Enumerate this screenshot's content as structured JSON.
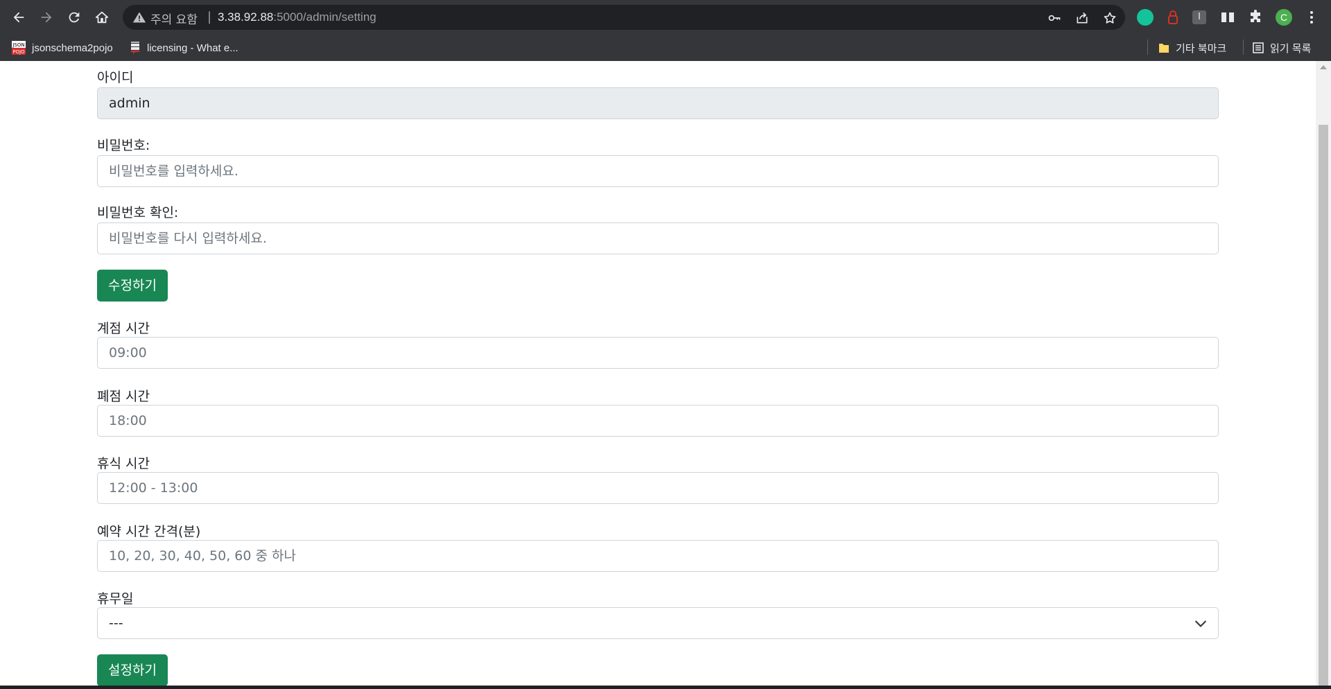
{
  "browser": {
    "security_warning": "주의 요함",
    "separator": "|",
    "url_host": "3.38.92.88",
    "url_path": ":5000/admin/setting",
    "profile_initial": "C",
    "extension_i_label": "I",
    "bookmarks": [
      {
        "label": "jsonschema2pojo",
        "icon": "json-pojo-icon"
      },
      {
        "label": "licensing - What e...",
        "icon": "stackexchange-icon"
      }
    ],
    "bookmarks_right": [
      {
        "label": "기타 북마크",
        "icon": "folder-icon"
      },
      {
        "label": "읽기 목록",
        "icon": "reading-list-icon"
      }
    ]
  },
  "form": {
    "id_label": "아이디",
    "id_value": "admin",
    "password_label": "비밀번호:",
    "password_placeholder": "비밀번호를 입력하세요.",
    "password_confirm_label": "비밀번호 확인:",
    "password_confirm_placeholder": "비밀번호를 다시 입력하세요.",
    "update_button": "수정하기",
    "open_time_label": "계점 시간",
    "open_time_placeholder": "09:00",
    "close_time_label": "폐점 시간",
    "close_time_placeholder": "18:00",
    "break_time_label": "휴식 시간",
    "break_time_placeholder": "12:00 - 13:00",
    "interval_label": "예약 시간 간격(분)",
    "interval_placeholder": "10, 20, 30, 40, 50, 60 중 하나",
    "holiday_label": "휴무일",
    "holiday_selected": "---",
    "settings_button": "설정하기"
  },
  "colors": {
    "button_green": "#198754",
    "chrome_dark": "#35363a",
    "omnibox": "#202124"
  }
}
